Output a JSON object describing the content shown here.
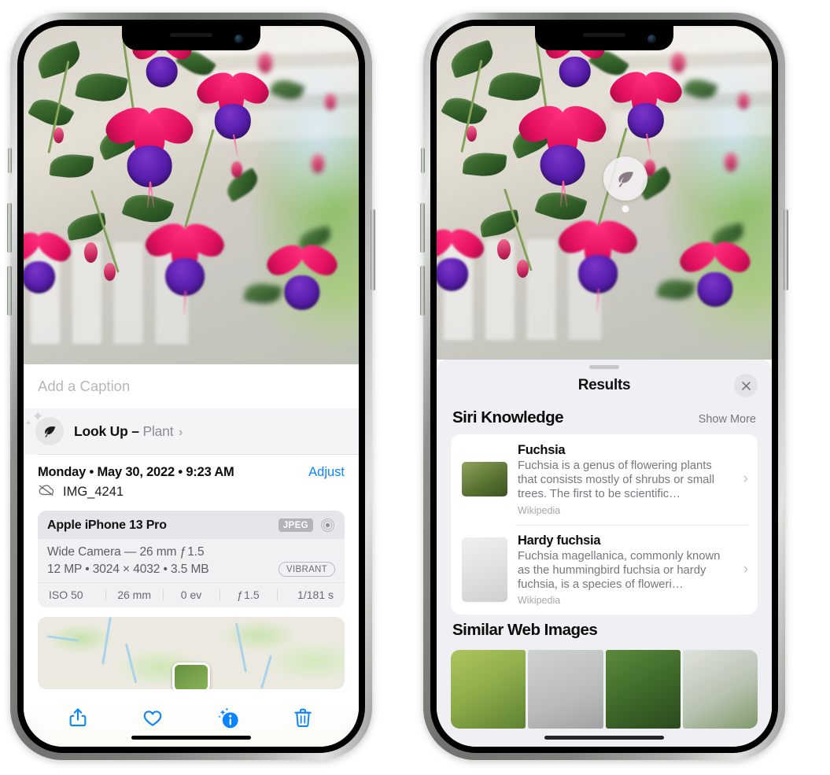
{
  "left_phone": {
    "name": "iPhone photo detail view",
    "caption_placeholder": "Add a Caption",
    "lookup": {
      "label": "Look Up",
      "separator": "–",
      "subject": "Plant",
      "chevron": "›",
      "icon": "leaf-icon",
      "sparkle": "✦"
    },
    "date": "Monday • May 30, 2022 • 9:23 AM",
    "adjust_label": "Adjust",
    "file_name": "IMG_4241",
    "file_icon": "icloud-slash-icon",
    "metadata": {
      "device": "Apple iPhone 13 Pro",
      "format_badge": "JPEG",
      "aperture_icon": "aperture-icon",
      "lens_line": "Wide Camera — 26 mm ƒ 1.5",
      "size_line": "12 MP • 3024 × 4032 • 3.5 MB",
      "style_badge": "VIBRANT",
      "exif": [
        "ISO 50",
        "26 mm",
        "0 ev",
        "ƒ 1.5",
        "1/181 s"
      ]
    },
    "toolbar": [
      {
        "name": "share-button",
        "icon": "share-icon"
      },
      {
        "name": "favorite-button",
        "icon": "heart-icon"
      },
      {
        "name": "info-button",
        "icon": "info-sparkle-icon"
      },
      {
        "name": "delete-button",
        "icon": "trash-icon"
      }
    ]
  },
  "right_phone": {
    "name": "iPhone Visual Look Up results view",
    "photo_badge_icon": "leaf-icon",
    "sheet": {
      "title": "Results",
      "close_icon": "close-icon",
      "sections": [
        {
          "title": "Siri Knowledge",
          "action": "Show More",
          "items": [
            {
              "title": "Fuchsia",
              "description": "Fuchsia is a genus of flowering plants that consists mostly of shrubs or small trees. The first to be scientific…",
              "source": "Wikipedia",
              "chevron": "›"
            },
            {
              "title": "Hardy fuchsia",
              "description": "Fuchsia magellanica, commonly known as the hummingbird fuchsia or hardy fuchsia, is a species of floweri…",
              "source": "Wikipedia",
              "chevron": "›"
            }
          ]
        },
        {
          "title": "Similar Web Images",
          "thumbnails": [
            "web-image-1",
            "web-image-2",
            "web-image-3",
            "web-image-4"
          ]
        }
      ]
    }
  },
  "colors": {
    "accent_blue": "#0a84ff",
    "sheet_background": "#f0eff4",
    "card_background": "#ffffff",
    "meta_card": "#f1f1f4",
    "secondary_text": "#77777d"
  }
}
